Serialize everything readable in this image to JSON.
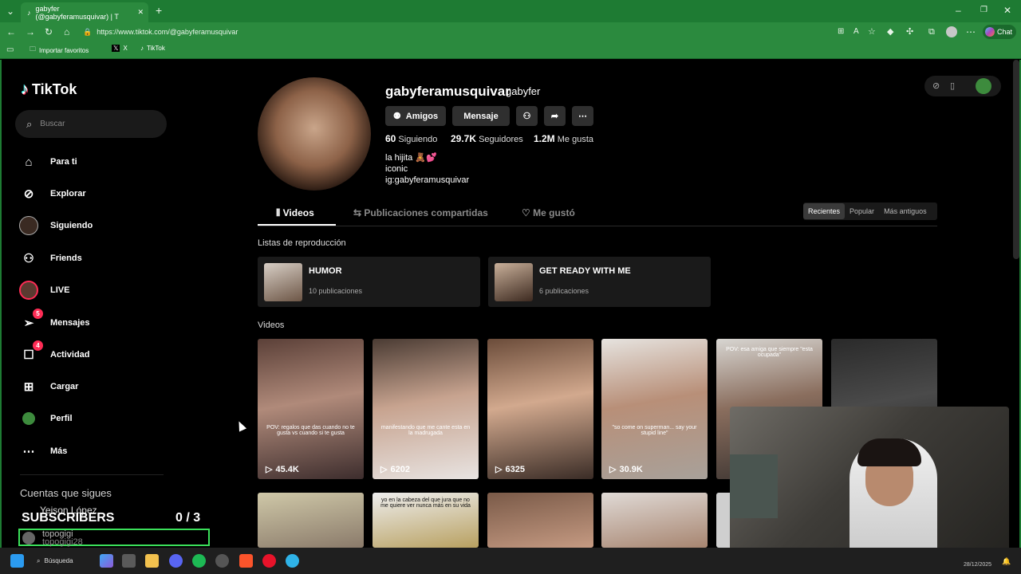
{
  "browser": {
    "tab_title": "gabyfer (@gabyferamusquivar) | T",
    "url": "https://www.tiktok.com/@gabyferamusquivar",
    "bookmarks": [
      "Importar favoritos",
      "X",
      "TikTok"
    ],
    "chat_label": "Chat"
  },
  "sidebar": {
    "logo": "TikTok",
    "search_placeholder": "Buscar",
    "items": [
      {
        "label": "Para ti",
        "icon": "home-icon"
      },
      {
        "label": "Explorar",
        "icon": "compass-icon"
      },
      {
        "label": "Siguiendo",
        "icon": "avatar-icon"
      },
      {
        "label": "Friends",
        "icon": "friends-icon"
      },
      {
        "label": "LIVE",
        "icon": "live-icon"
      },
      {
        "label": "Mensajes",
        "icon": "message-icon",
        "badge": "5"
      },
      {
        "label": "Actividad",
        "icon": "activity-icon",
        "badge": "4"
      },
      {
        "label": "Cargar",
        "icon": "upload-icon"
      },
      {
        "label": "Perfil",
        "icon": "profile-icon"
      },
      {
        "label": "Más",
        "icon": "more-icon"
      }
    ],
    "following_heading": "Cuentas que sigues",
    "following_partial": "Yeison López",
    "following_item": "topogigi",
    "following_item_sub": "topogigi28"
  },
  "overlay": {
    "subscribers_label": "SUBSCRIBERS",
    "subscribers_count": "0  / 3"
  },
  "profile": {
    "username": "gabyferamusquivar",
    "nickname": "gabyfer",
    "buttons": {
      "friends": "Amigos",
      "message": "Mensaje"
    },
    "stats": {
      "following_value": "60",
      "following_label": "Siguiendo",
      "followers_value": "29.7K",
      "followers_label": "Seguidores",
      "likes_value": "1.2M",
      "likes_label": "Me gusta"
    },
    "bio": [
      "la hijita 🧸💕",
      "iconic",
      "ig:gabyferamusquivar"
    ]
  },
  "tabs": [
    "Videos",
    "Publicaciones compartidas",
    "Me gustó"
  ],
  "sort": [
    "Recientes",
    "Popular",
    "Más antiguos"
  ],
  "playlists": {
    "heading": "Listas de reproducción",
    "items": [
      {
        "title": "HUMOR",
        "count": "10 publicaciones"
      },
      {
        "title": "GET READY WITH ME",
        "count": "6 publicaciones"
      }
    ]
  },
  "videos": {
    "heading": "Videos",
    "items": [
      {
        "views": "45.4K",
        "caption": "POV: regalos que das cuando no te gusta vs cuando si te gusta"
      },
      {
        "views": "6202",
        "caption": "manifestando que me cante esta en la madrugada"
      },
      {
        "views": "6325",
        "caption": ""
      },
      {
        "views": "30.9K",
        "caption": "\"so come on superman... say your stupid line\""
      },
      {
        "views": "",
        "caption": "POV: esa amiga que siempre \"esta ocupada\""
      },
      {
        "views": "",
        "caption": ""
      }
    ],
    "row2_caption": "yo en la cabeza del que jura que no me quiere ver nunca más en su vida"
  },
  "taskbar": {
    "search_label": "Búsqueda",
    "date": "28/12/2025"
  }
}
